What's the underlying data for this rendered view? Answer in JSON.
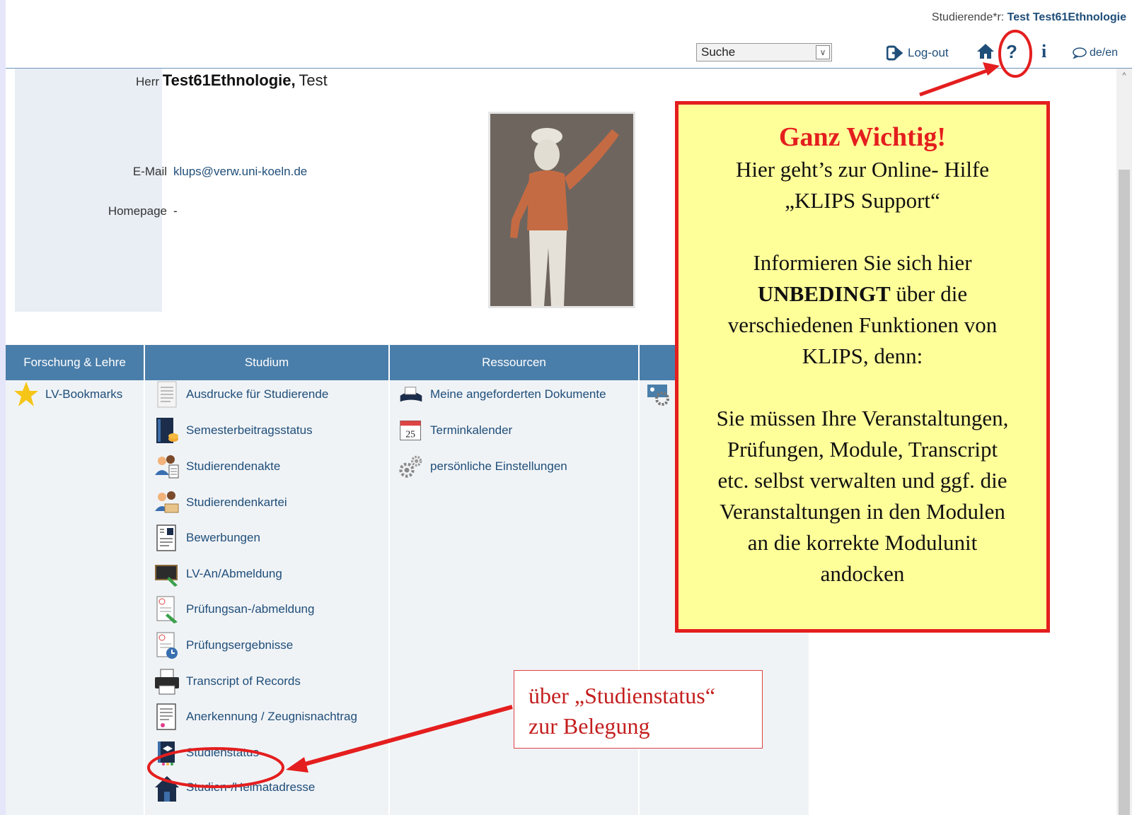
{
  "header": {
    "user_label": "Studierende*r:",
    "user_name": "Test Test61Ethnologie",
    "search_value": "Suche",
    "logout_label": "Log-out",
    "lang_label": "de/en"
  },
  "person": {
    "salutation": "Herr",
    "surname": "Test61Ethnologie,",
    "firstname": "Test",
    "email_label": "E-Mail",
    "email_value": "klups@verw.uni-koeln.de",
    "homepage_label": "Homepage",
    "homepage_value": "-"
  },
  "menu": {
    "columns": [
      {
        "title": "Forschung & Lehre",
        "items": [
          "LV-Bookmarks"
        ]
      },
      {
        "title": "Studium",
        "items": [
          "Ausdrucke für Studierende",
          "Semesterbeitragsstatus",
          "Studierendenakte",
          "Studierendenkartei",
          "Bewerbungen",
          "LV-An/Abmeldung",
          "Prüfungsan-/abmeldung",
          "Prüfungsergebnisse",
          "Transcript of Records",
          "Anerkennung / Zeugnisnachtrag",
          "Studienstatus",
          "Studien-/Heimatadresse"
        ]
      },
      {
        "title": "Ressourcen",
        "items": [
          "Meine angeforderten Dokumente",
          "Terminkalender",
          "persönliche Einstellungen"
        ]
      },
      {
        "title": "",
        "items": []
      }
    ]
  },
  "annotations": {
    "callout_title": "Ganz Wichtig!",
    "callout_lines_1": [
      "Hier geht’s zur Online- Hilfe",
      "„KLIPS Support“"
    ],
    "callout_line_2a": "Informieren Sie sich hier",
    "callout_line_2b_bold": "UNBEDINGT",
    "callout_line_2b_rest": " über die",
    "callout_lines_2c": [
      "verschiedenen Funktionen von",
      "KLIPS, denn:"
    ],
    "callout_lines_3": [
      "Sie müssen Ihre Veranstaltungen,",
      "Prüfungen, Module, Transcript",
      "etc. selbst verwalten und ggf. die",
      "Veranstaltungen in den Modulen",
      "an die korrekte Modulunit",
      "andocken"
    ],
    "note_lines": [
      "über „Studienstatus“",
      "zur Belegung"
    ]
  },
  "colors": {
    "accent": "#4a7eaa",
    "link": "#1f4e79",
    "annotation_red": "#e41e1e",
    "callout_bg": "#ffff9a"
  }
}
